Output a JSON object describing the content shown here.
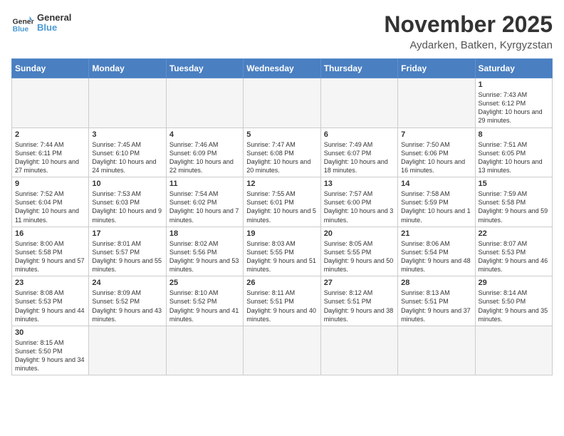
{
  "header": {
    "logo_general": "General",
    "logo_blue": "Blue",
    "month_title": "November 2025",
    "location": "Aydarken, Batken, Kyrgyzstan"
  },
  "weekdays": [
    "Sunday",
    "Monday",
    "Tuesday",
    "Wednesday",
    "Thursday",
    "Friday",
    "Saturday"
  ],
  "weeks": [
    [
      {
        "day": "",
        "info": ""
      },
      {
        "day": "",
        "info": ""
      },
      {
        "day": "",
        "info": ""
      },
      {
        "day": "",
        "info": ""
      },
      {
        "day": "",
        "info": ""
      },
      {
        "day": "",
        "info": ""
      },
      {
        "day": "1",
        "info": "Sunrise: 7:43 AM\nSunset: 6:12 PM\nDaylight: 10 hours and 29 minutes."
      }
    ],
    [
      {
        "day": "2",
        "info": "Sunrise: 7:44 AM\nSunset: 6:11 PM\nDaylight: 10 hours and 27 minutes."
      },
      {
        "day": "3",
        "info": "Sunrise: 7:45 AM\nSunset: 6:10 PM\nDaylight: 10 hours and 24 minutes."
      },
      {
        "day": "4",
        "info": "Sunrise: 7:46 AM\nSunset: 6:09 PM\nDaylight: 10 hours and 22 minutes."
      },
      {
        "day": "5",
        "info": "Sunrise: 7:47 AM\nSunset: 6:08 PM\nDaylight: 10 hours and 20 minutes."
      },
      {
        "day": "6",
        "info": "Sunrise: 7:49 AM\nSunset: 6:07 PM\nDaylight: 10 hours and 18 minutes."
      },
      {
        "day": "7",
        "info": "Sunrise: 7:50 AM\nSunset: 6:06 PM\nDaylight: 10 hours and 16 minutes."
      },
      {
        "day": "8",
        "info": "Sunrise: 7:51 AM\nSunset: 6:05 PM\nDaylight: 10 hours and 13 minutes."
      }
    ],
    [
      {
        "day": "9",
        "info": "Sunrise: 7:52 AM\nSunset: 6:04 PM\nDaylight: 10 hours and 11 minutes."
      },
      {
        "day": "10",
        "info": "Sunrise: 7:53 AM\nSunset: 6:03 PM\nDaylight: 10 hours and 9 minutes."
      },
      {
        "day": "11",
        "info": "Sunrise: 7:54 AM\nSunset: 6:02 PM\nDaylight: 10 hours and 7 minutes."
      },
      {
        "day": "12",
        "info": "Sunrise: 7:55 AM\nSunset: 6:01 PM\nDaylight: 10 hours and 5 minutes."
      },
      {
        "day": "13",
        "info": "Sunrise: 7:57 AM\nSunset: 6:00 PM\nDaylight: 10 hours and 3 minutes."
      },
      {
        "day": "14",
        "info": "Sunrise: 7:58 AM\nSunset: 5:59 PM\nDaylight: 10 hours and 1 minute."
      },
      {
        "day": "15",
        "info": "Sunrise: 7:59 AM\nSunset: 5:58 PM\nDaylight: 9 hours and 59 minutes."
      }
    ],
    [
      {
        "day": "16",
        "info": "Sunrise: 8:00 AM\nSunset: 5:58 PM\nDaylight: 9 hours and 57 minutes."
      },
      {
        "day": "17",
        "info": "Sunrise: 8:01 AM\nSunset: 5:57 PM\nDaylight: 9 hours and 55 minutes."
      },
      {
        "day": "18",
        "info": "Sunrise: 8:02 AM\nSunset: 5:56 PM\nDaylight: 9 hours and 53 minutes."
      },
      {
        "day": "19",
        "info": "Sunrise: 8:03 AM\nSunset: 5:55 PM\nDaylight: 9 hours and 51 minutes."
      },
      {
        "day": "20",
        "info": "Sunrise: 8:05 AM\nSunset: 5:55 PM\nDaylight: 9 hours and 50 minutes."
      },
      {
        "day": "21",
        "info": "Sunrise: 8:06 AM\nSunset: 5:54 PM\nDaylight: 9 hours and 48 minutes."
      },
      {
        "day": "22",
        "info": "Sunrise: 8:07 AM\nSunset: 5:53 PM\nDaylight: 9 hours and 46 minutes."
      }
    ],
    [
      {
        "day": "23",
        "info": "Sunrise: 8:08 AM\nSunset: 5:53 PM\nDaylight: 9 hours and 44 minutes."
      },
      {
        "day": "24",
        "info": "Sunrise: 8:09 AM\nSunset: 5:52 PM\nDaylight: 9 hours and 43 minutes."
      },
      {
        "day": "25",
        "info": "Sunrise: 8:10 AM\nSunset: 5:52 PM\nDaylight: 9 hours and 41 minutes."
      },
      {
        "day": "26",
        "info": "Sunrise: 8:11 AM\nSunset: 5:51 PM\nDaylight: 9 hours and 40 minutes."
      },
      {
        "day": "27",
        "info": "Sunrise: 8:12 AM\nSunset: 5:51 PM\nDaylight: 9 hours and 38 minutes."
      },
      {
        "day": "28",
        "info": "Sunrise: 8:13 AM\nSunset: 5:51 PM\nDaylight: 9 hours and 37 minutes."
      },
      {
        "day": "29",
        "info": "Sunrise: 8:14 AM\nSunset: 5:50 PM\nDaylight: 9 hours and 35 minutes."
      }
    ],
    [
      {
        "day": "30",
        "info": "Sunrise: 8:15 AM\nSunset: 5:50 PM\nDaylight: 9 hours and 34 minutes."
      },
      {
        "day": "",
        "info": ""
      },
      {
        "day": "",
        "info": ""
      },
      {
        "day": "",
        "info": ""
      },
      {
        "day": "",
        "info": ""
      },
      {
        "day": "",
        "info": ""
      },
      {
        "day": "",
        "info": ""
      }
    ]
  ]
}
